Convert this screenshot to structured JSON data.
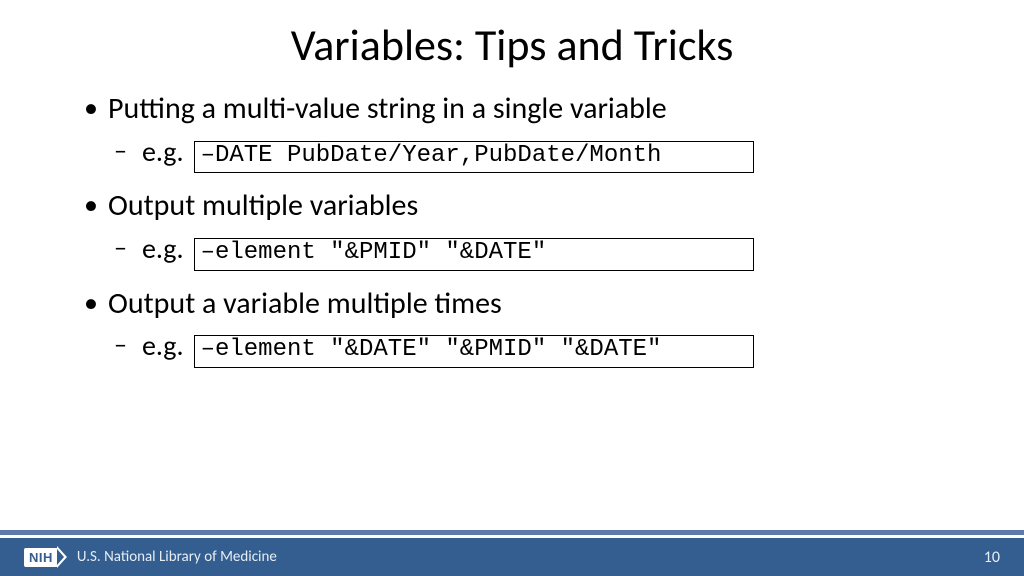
{
  "title": "Variables: Tips and Tricks",
  "bullets": [
    {
      "text": "Putting a multi-value string in a single variable",
      "sub": {
        "label": "e.g.",
        "code": "–DATE PubDate/Year,PubDate/Month"
      }
    },
    {
      "text": "Output multiple variables",
      "sub": {
        "label": "e.g.",
        "code": "–element \"&PMID\" \"&DATE\""
      }
    },
    {
      "text": "Output a variable multiple times",
      "sub": {
        "label": "e.g.",
        "code": "–element \"&DATE\" \"&PMID\" \"&DATE\""
      }
    }
  ],
  "footer": {
    "badge": "NIH",
    "org": "U.S. National Library of Medicine",
    "page": "10"
  }
}
